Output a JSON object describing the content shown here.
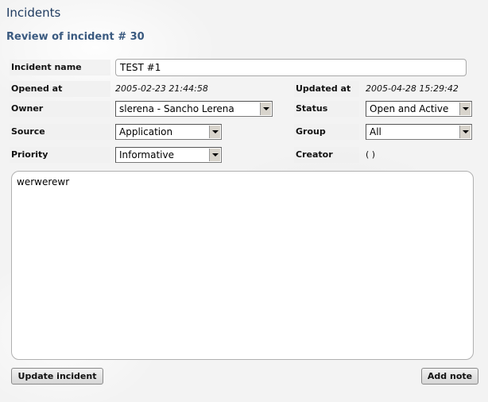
{
  "page_title": "Incidents",
  "sub_title": "Review of incident # 30",
  "fields": {
    "incident_name_label": "Incident name",
    "incident_name_value": "TEST #1",
    "opened_at_label": "Opened at",
    "opened_at_value": "2005-02-23 21:44:58",
    "updated_at_label": "Updated at",
    "updated_at_value": "2005-04-28 15:29:42",
    "owner_label": "Owner",
    "owner_value": "slerena - Sancho Lerena",
    "status_label": "Status",
    "status_value": "Open and Active",
    "source_label": "Source",
    "source_value": "Application",
    "group_label": "Group",
    "group_value": "All",
    "priority_label": "Priority",
    "priority_value": "Informative",
    "creator_label": "Creator",
    "creator_value": "( )"
  },
  "description": "werwerewr",
  "buttons": {
    "update_label": "Update incident",
    "add_note_label": "Add note"
  }
}
